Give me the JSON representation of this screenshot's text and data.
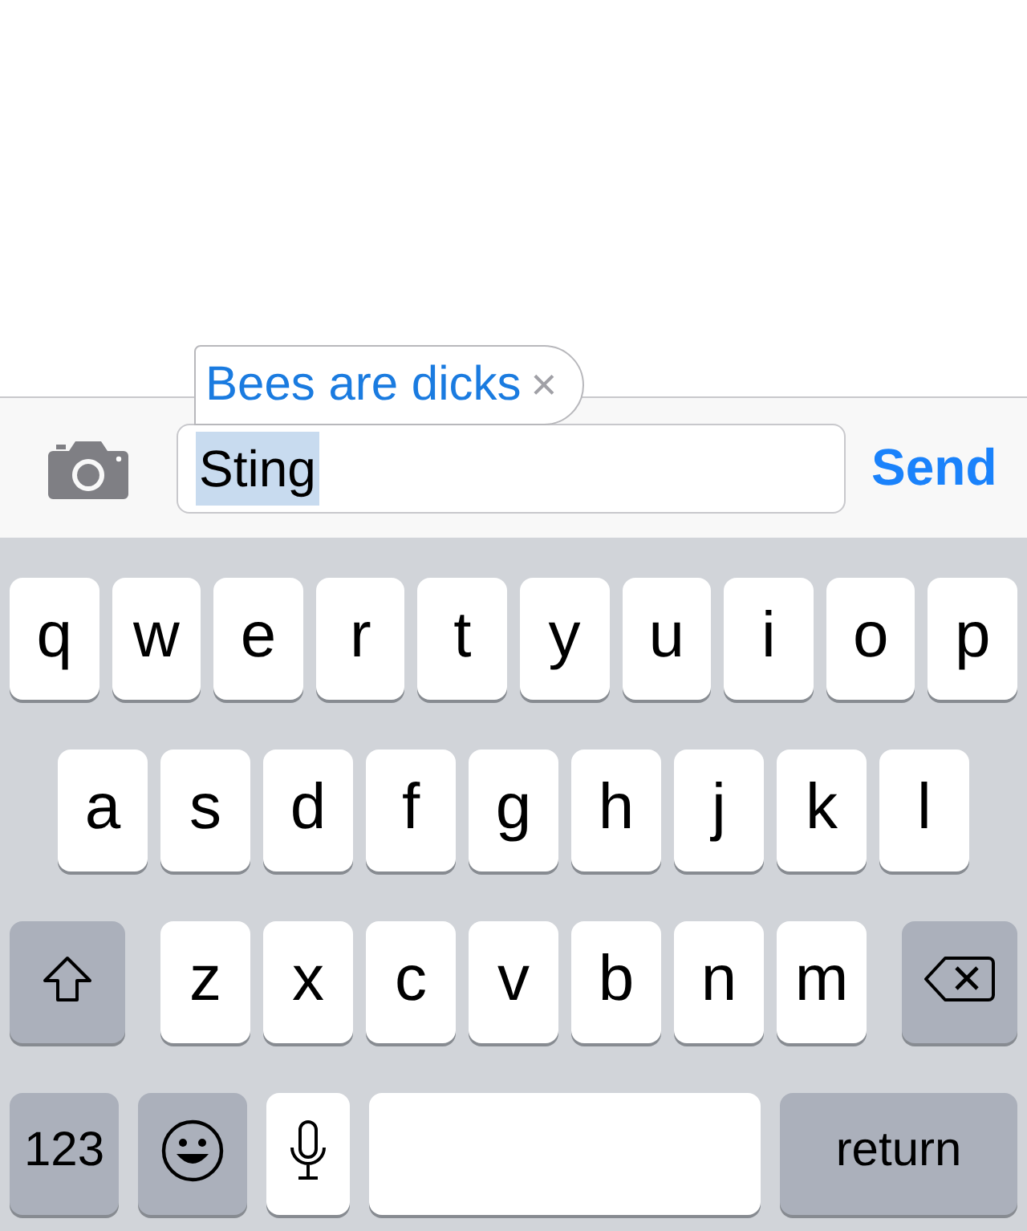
{
  "autocorrect": {
    "suggestion": "Bees are dicks",
    "dismiss": "×"
  },
  "message_bar": {
    "field": {
      "value": "Sting",
      "selected": true
    },
    "send": "Send"
  },
  "keyboard": {
    "rows": [
      {
        "keys": [
          {
            "kind": "letter",
            "label": "q"
          },
          {
            "kind": "letter",
            "label": "w"
          },
          {
            "kind": "letter",
            "label": "e"
          },
          {
            "kind": "letter",
            "label": "r"
          },
          {
            "kind": "letter",
            "label": "t"
          },
          {
            "kind": "letter",
            "label": "y"
          },
          {
            "kind": "letter",
            "label": "u"
          },
          {
            "kind": "letter",
            "label": "i"
          },
          {
            "kind": "letter",
            "label": "o"
          },
          {
            "kind": "letter",
            "label": "p"
          }
        ]
      },
      {
        "keys": [
          {
            "kind": "letter",
            "label": "a"
          },
          {
            "kind": "letter",
            "label": "s"
          },
          {
            "kind": "letter",
            "label": "d"
          },
          {
            "kind": "letter",
            "label": "f"
          },
          {
            "kind": "letter",
            "label": "g"
          },
          {
            "kind": "letter",
            "label": "h"
          },
          {
            "kind": "letter",
            "label": "j"
          },
          {
            "kind": "letter",
            "label": "k"
          },
          {
            "kind": "letter",
            "label": "l"
          }
        ]
      },
      {
        "keys": [
          {
            "kind": "shift"
          },
          {
            "kind": "letter",
            "label": "z"
          },
          {
            "kind": "letter",
            "label": "x"
          },
          {
            "kind": "letter",
            "label": "c"
          },
          {
            "kind": "letter",
            "label": "v"
          },
          {
            "kind": "letter",
            "label": "b"
          },
          {
            "kind": "letter",
            "label": "n"
          },
          {
            "kind": "letter",
            "label": "m"
          },
          {
            "kind": "delete"
          }
        ]
      },
      {
        "keys": [
          {
            "kind": "mode",
            "label": "123"
          },
          {
            "kind": "emoji"
          },
          {
            "kind": "mic"
          },
          {
            "kind": "space"
          },
          {
            "kind": "return",
            "label": "return"
          }
        ]
      }
    ]
  }
}
